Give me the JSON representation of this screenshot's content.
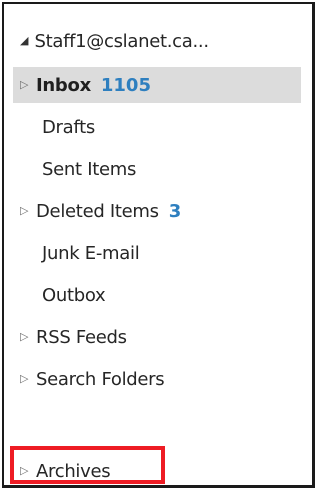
{
  "account": {
    "caret": "◢",
    "name": "Staff1@cslanet.ca..."
  },
  "folders": [
    {
      "label": "Inbox",
      "count": "1105",
      "expander": "▷",
      "selected": true
    },
    {
      "label": "Drafts"
    },
    {
      "label": "Sent Items"
    },
    {
      "label": "Deleted Items",
      "count": "3",
      "expander": "▷"
    },
    {
      "label": "Junk E-mail"
    },
    {
      "label": "Outbox"
    },
    {
      "label": "RSS Feeds",
      "expander": "▷"
    },
    {
      "label": "Search Folders",
      "expander": "▷"
    }
  ],
  "archives": {
    "label": "Archives",
    "expander": "▷",
    "highlighted": true
  },
  "colors": {
    "count": "#2e7fbf",
    "selected_background": "#dcdcdc",
    "highlight_border": "#ee1c24"
  },
  "icons": {
    "account_expander": "collapse-triangle-icon",
    "folder_expander": "expand-triangle-icon"
  }
}
